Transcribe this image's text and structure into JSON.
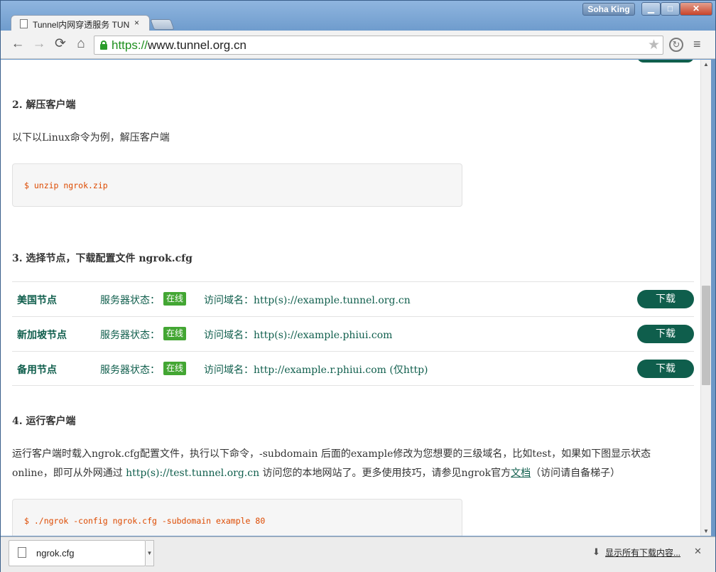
{
  "window": {
    "user": "Soha King",
    "controls": {
      "minimize": "▁",
      "maximize": "□",
      "close": "✕"
    }
  },
  "tab": {
    "title": "Tunnel内网穿透服务 TUN",
    "close": "×"
  },
  "toolbar": {
    "back": "←",
    "forward": "→",
    "reload": "⟳",
    "home": "⌂",
    "url_scheme": "https://",
    "url_rest": "www.tunnel.org.cn",
    "star": "★",
    "menu": "≡"
  },
  "content": {
    "step2": {
      "heading": "2. 解压客户端",
      "text": "以下以Linux命令为例，解压客户端",
      "code": "$ unzip ngrok.zip"
    },
    "step3": {
      "heading": "3. 选择节点，下载配置文件 ngrok.cfg"
    },
    "nodes": [
      {
        "name": "美国节点",
        "status_label": "服务器状态：",
        "status": "在线",
        "domain": "访问域名：http(s)://example.tunnel.org.cn",
        "button": "下载"
      },
      {
        "name": "新加坡节点",
        "status_label": "服务器状态：",
        "status": "在线",
        "domain": "访问域名：http(s)://example.phiui.com",
        "button": "下载"
      },
      {
        "name": "备用节点",
        "status_label": "服务器状态：",
        "status": "在线",
        "domain": "访问域名：http://example.r.phiui.com (仅http)",
        "button": "下载"
      }
    ],
    "step4": {
      "heading": "4. 运行客户端",
      "line1": "运行客户端时载入ngrok.cfg配置文件，执行以下命令，-subdomain 后面的example修改为您想要的三级域名，比如test，如果如下图显示状态",
      "line2_a": "online，即可从外网通过 ",
      "line2_code": "http(s)://test.tunnel.org.cn",
      "line2_b": " 访问您的本地网站了。更多使用技巧，请参见ngrok官方",
      "line2_link": "文档",
      "line2_c": "（访问请自备梯子）",
      "code": "$ ./ngrok -config ngrok.cfg -subdomain example 80"
    }
  },
  "downloads": {
    "file": "ngrok.cfg",
    "show_all": "显示所有下载内容...",
    "close": "✕"
  },
  "colors": {
    "accent": "#0f5e4c",
    "badge": "#43a633",
    "code_text": "#dd4a00"
  }
}
